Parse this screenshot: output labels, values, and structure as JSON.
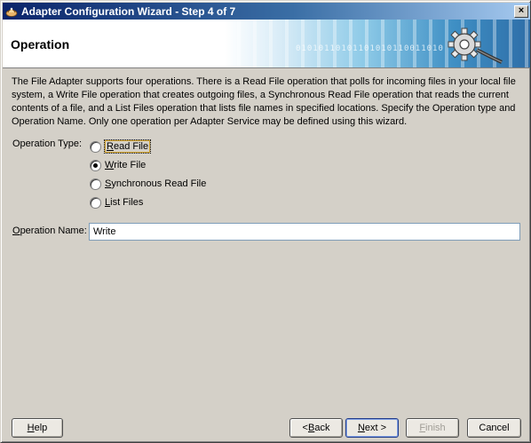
{
  "window": {
    "title": "Adapter Configuration Wizard - Step 4 of 7",
    "close_label": "×"
  },
  "banner": {
    "page_title": "Operation",
    "binary_text": "01010110101101010110011010"
  },
  "description": "The File Adapter supports four operations.  There is a Read File operation that polls for incoming files in your local file system, a Write File operation that creates outgoing files, a Synchronous Read File operation that reads the current contents of a file, and a List Files operation that lists file names in specified locations.  Specify the Operation type and Operation Name.  Only one operation per Adapter Service may be defined using this wizard.",
  "operation_type": {
    "label": "Operation Type:",
    "options": [
      {
        "label": "Read File",
        "mnemonic": "R",
        "rest": "ead File",
        "selected": false
      },
      {
        "label": "Write File",
        "mnemonic": "W",
        "rest": "rite File",
        "selected": true
      },
      {
        "label": "Synchronous Read File",
        "mnemonic": "S",
        "rest": "ynchronous Read File",
        "selected": false
      },
      {
        "label": "List Files",
        "mnemonic": "L",
        "rest": "ist Files",
        "selected": false
      }
    ]
  },
  "operation_name": {
    "label": "Operation Name:",
    "mnemonic": "O",
    "rest": "peration Name:",
    "value": "Write"
  },
  "buttons": {
    "help": {
      "label": "Help",
      "mnemonic": "H",
      "rest": "elp"
    },
    "back": {
      "label": "< Back",
      "pre": "< ",
      "mnemonic": "B",
      "rest": "ack"
    },
    "next": {
      "label": "Next >",
      "mnemonic": "N",
      "rest": "ext >"
    },
    "finish": {
      "label": "Finish",
      "mnemonic": "F",
      "rest": "inish"
    },
    "cancel": {
      "label": "Cancel"
    }
  },
  "colors": {
    "titlebar_start": "#0a246a",
    "titlebar_end": "#a6caf0",
    "dialog_bg": "#d4d0c8"
  }
}
